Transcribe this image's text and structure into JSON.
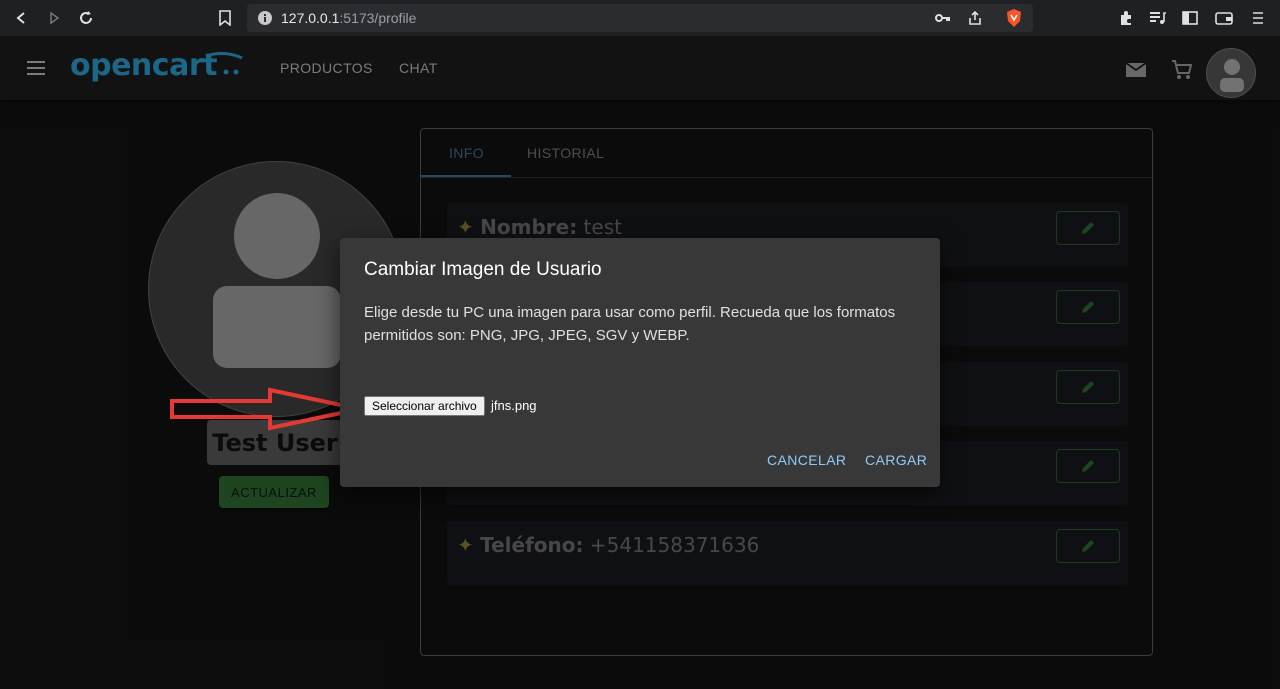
{
  "browser": {
    "url_host": "127.0.0.1",
    "url_path": ":5173/profile"
  },
  "header": {
    "logo": "opencart",
    "nav": [
      "PRODUCTOS",
      "CHAT"
    ]
  },
  "profile": {
    "username": "Test User",
    "update_label": "ACTUALIZAR"
  },
  "tabs": [
    {
      "label": "INFO",
      "active": true
    },
    {
      "label": "HISTORIAL",
      "active": false
    }
  ],
  "info_rows": [
    {
      "label": "Nombre:",
      "value": "test"
    },
    {
      "label": "",
      "value": ""
    },
    {
      "label": "",
      "value": ""
    },
    {
      "label": "",
      "value": ""
    },
    {
      "label": "Teléfono:",
      "value": "+541158371636"
    }
  ],
  "dialog": {
    "title": "Cambiar Imagen de Usuario",
    "text": "Elige desde tu PC una imagen para usar como perfil. Recueda que los formatos permitidos son: PNG, JPG, JPEG, SGV y WEBP.",
    "file_button": "Seleccionar archivo",
    "file_name": "jfns.png",
    "cancel": "CANCELAR",
    "upload": "CARGAR"
  },
  "colors": {
    "accent": "#90caf9",
    "logo": "#2a9fd0",
    "update_button": "#2e6b30",
    "arrow": "#e53935"
  }
}
